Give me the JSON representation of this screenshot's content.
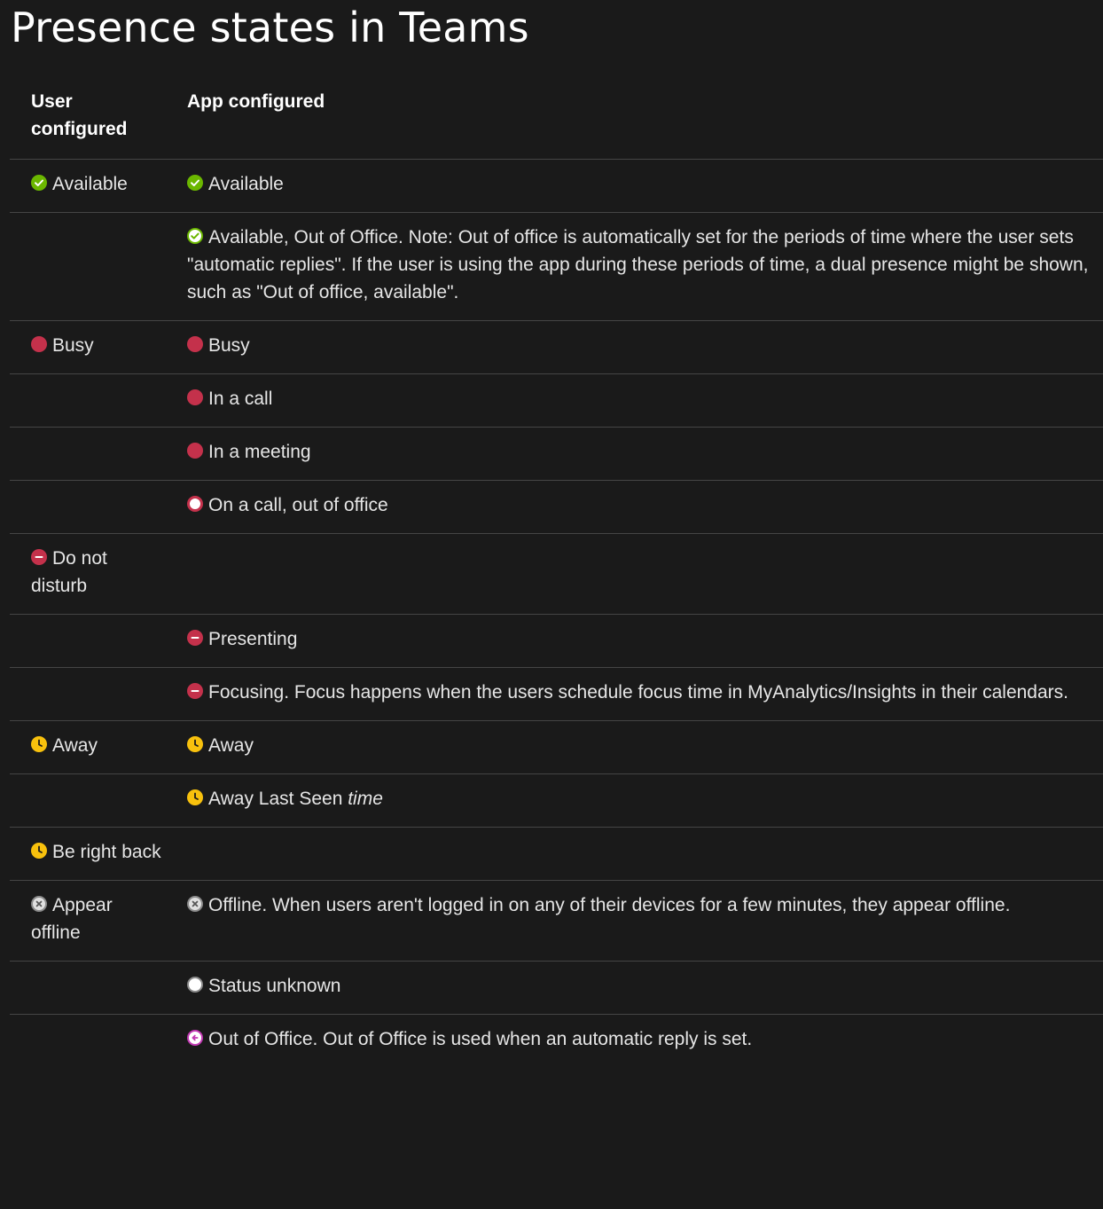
{
  "page": {
    "title": "Presence states in Teams"
  },
  "table": {
    "headers": {
      "user": "User configured",
      "app": "App configured"
    },
    "rows": [
      {
        "user_icon": "available-icon",
        "user": "Available",
        "app_icon": "available-icon",
        "app": "Available"
      },
      {
        "user_icon": "",
        "user": "",
        "app_icon": "available-out-of-office-icon",
        "app": "Available, Out of Office. Note: Out of office is automatically set for the periods of time where the user sets \"automatic replies\". If the user is using the app during these periods of time, a dual presence might be shown, such as \"Out of office, available\"."
      },
      {
        "user_icon": "busy-icon",
        "user": "Busy",
        "app_icon": "busy-icon",
        "app": "Busy"
      },
      {
        "user_icon": "",
        "user": "",
        "app_icon": "busy-icon",
        "app": "In a call"
      },
      {
        "user_icon": "",
        "user": "",
        "app_icon": "busy-icon",
        "app": "In a meeting"
      },
      {
        "user_icon": "",
        "user": "",
        "app_icon": "busy-out-of-office-icon",
        "app": "On a call, out of office"
      },
      {
        "user_icon": "do-not-disturb-icon",
        "user": "Do not disturb",
        "app_icon": "",
        "app": ""
      },
      {
        "user_icon": "",
        "user": "",
        "app_icon": "do-not-disturb-icon",
        "app": "Presenting"
      },
      {
        "user_icon": "",
        "user": "",
        "app_icon": "do-not-disturb-icon",
        "app": "Focusing. Focus happens when the users schedule focus time in MyAnalytics/Insights in their calendars."
      },
      {
        "user_icon": "away-icon",
        "user": "Away",
        "app_icon": "away-icon",
        "app": "Away"
      },
      {
        "user_icon": "",
        "user": "",
        "app_icon": "away-icon",
        "app": "Away Last Seen ",
        "app_emphasis": "time"
      },
      {
        "user_icon": "away-icon",
        "user": "Be right back",
        "app_icon": "",
        "app": ""
      },
      {
        "user_icon": "offline-icon",
        "user": "Appear offline",
        "app_icon": "offline-icon",
        "app": "Offline. When users aren't logged in on any of their devices for a few minutes, they appear offline."
      },
      {
        "user_icon": "",
        "user": "",
        "app_icon": "status-unknown-icon",
        "app": "Status unknown"
      },
      {
        "user_icon": "",
        "user": "",
        "app_icon": "out-of-office-icon",
        "app": "Out of Office. Out of Office is used when an automatic reply is set."
      }
    ]
  },
  "colors": {
    "background": "#1a1a1a",
    "text": "#e6e6e6",
    "divider": "#454545",
    "available": "#6bb700",
    "busy": "#c4314b",
    "away": "#f8c10d",
    "offline": "#8a8a8a",
    "out_of_office": "#c239b3"
  }
}
